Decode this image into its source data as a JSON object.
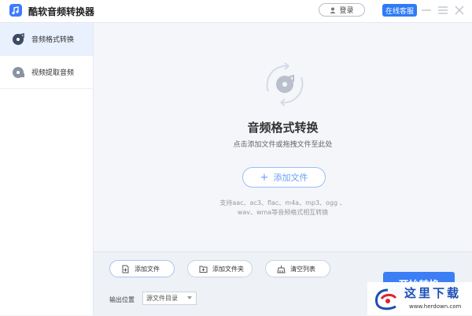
{
  "app": {
    "title": "酷软音频转换器"
  },
  "header": {
    "login_label": "登录",
    "support_label": "在线客服"
  },
  "sidebar": {
    "items": [
      {
        "label": "音频格式转换",
        "active": true
      },
      {
        "label": "视频提取音频",
        "active": false
      }
    ]
  },
  "main": {
    "title": "音频格式转换",
    "subtitle": "点击添加文件或拖拽文件至此处",
    "add_file_label": "添加文件",
    "formats_line1": "支持aac、ac3、flac、m4a、mp3、ogg 、",
    "formats_line2": "wav、wma等音频格式相互转换"
  },
  "toolbar": {
    "add_file": "添加文件",
    "add_folder": "添加文件夹",
    "clear_list": "清空列表",
    "output_label": "输出位置",
    "output_value": "源文件目录",
    "start_label": "开始转换"
  },
  "watermark": {
    "text": "这里下载",
    "url": "www.herdown.com"
  },
  "colors": {
    "accent": "#2f7bf6",
    "active_bg": "#e9f0fe"
  }
}
